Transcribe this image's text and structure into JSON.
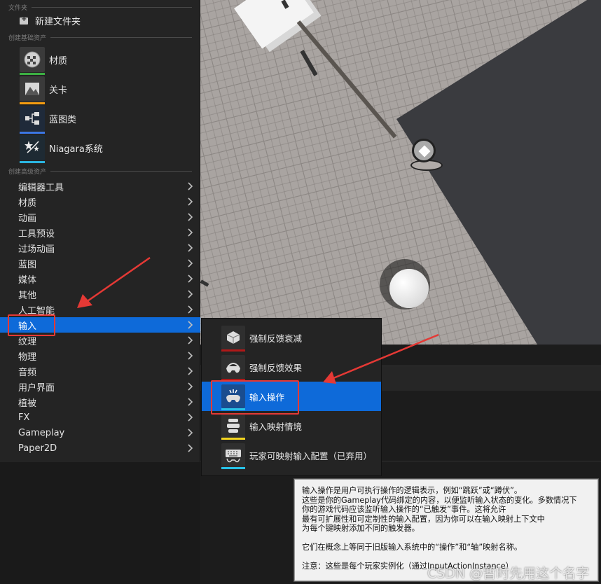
{
  "menu": {
    "section_folder": "文件夹",
    "new_folder": "新建文件夹",
    "section_basic": "创建基础资产",
    "basic_assets": [
      {
        "label": "材质",
        "bar_color": "#3cb043",
        "icon": "material-icon"
      },
      {
        "label": "关卡",
        "bar_color": "#f39c12",
        "icon": "level-icon"
      },
      {
        "label": "蓝图类",
        "bar_color": "#3b78e7",
        "icon": "blueprint-icon"
      },
      {
        "label": "Niagara系统",
        "bar_color": "#2bb5e0",
        "icon": "niagara-icon"
      }
    ],
    "section_advanced": "创建高级资产",
    "categories": [
      "编辑器工具",
      "材质",
      "动画",
      "工具预设",
      "过场动画",
      "蓝图",
      "媒体",
      "其他",
      "人工智能",
      "输入",
      "纹理",
      "物理",
      "音频",
      "用户界面",
      "植被",
      "FX",
      "Gameplay",
      "Paper2D"
    ],
    "selected_category": "输入"
  },
  "submenu": {
    "items": [
      {
        "label": "强制反馈衰减",
        "bar_color": "#b01818",
        "icon": "force-feedback-attenuation-icon"
      },
      {
        "label": "强制反馈效果",
        "bar_color": "#b01818",
        "icon": "force-feedback-effect-icon"
      },
      {
        "label": "输入操作",
        "bar_color": "#27c2e8",
        "icon": "input-action-icon"
      },
      {
        "label": "输入映射情境",
        "bar_color": "#f2d41f",
        "icon": "input-mapping-context-icon"
      },
      {
        "label": "玩家可映射输入配置（已弃用）",
        "bar_color": "#27c2e8",
        "icon": "player-mappable-input-config-icon"
      }
    ],
    "selected": "输入操作"
  },
  "tooltip": {
    "line1": "输入操作是用户可执行操作的逻辑表示，例如“跳跃”或“蹲伏”。",
    "line2": "这些是你的Gameplay代码绑定的内容，以便监听输入状态的变化。多数情况下",
    "line3": "你的游戏代码应该监听输入操作的“已触发”事件。这将允许",
    "line4": "最有可扩展性和可定制性的输入配置，因为你可以在输入映射上下文中",
    "line5": "为每个键映射添加不同的触发器。",
    "line6": "它们在概念上等同于旧版输入系统中的“操作”和“轴”映射名称。",
    "line7": "注意：这些是每个玩家实例化（通过InputActionInstance）"
  },
  "watermark": "CSDN @暂时先用这个名字",
  "colors": {
    "selection": "#0e6ad9",
    "annotation": "#e53935"
  }
}
